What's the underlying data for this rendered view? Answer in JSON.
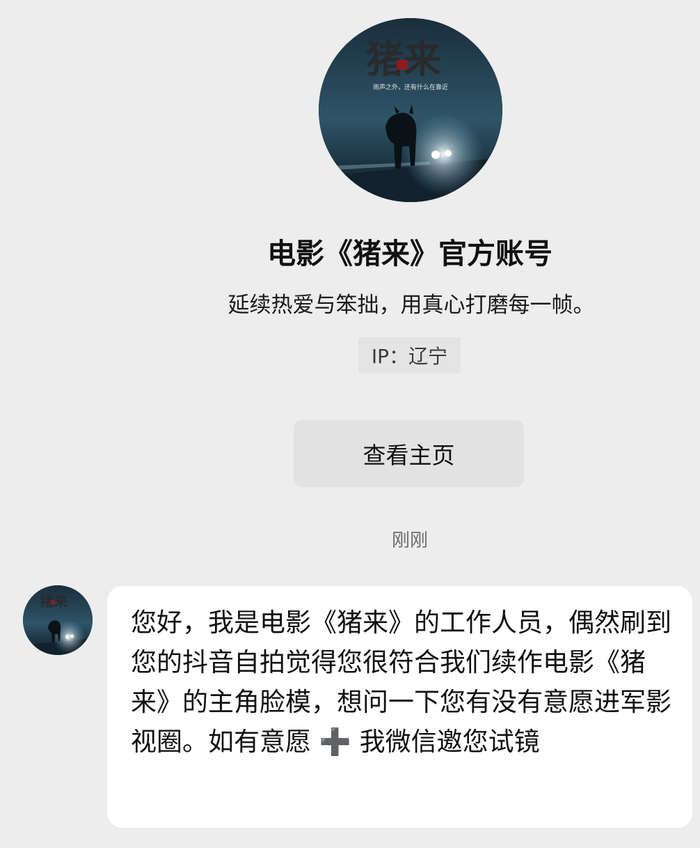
{
  "profile": {
    "avatar_icon": "movie-poster-avatar",
    "name": "电影《猪来》官方账号",
    "bio": "延续热爱与笨拙，用真心打磨每一帧。",
    "ip_location": "IP：辽宁",
    "view_homepage_label": "查看主页"
  },
  "poster": {
    "title": "猪来",
    "tagline": "雨声之外，还有什么在靠近"
  },
  "chat": {
    "timestamp": "刚刚",
    "message": {
      "sender_avatar_icon": "movie-poster-avatar",
      "text": "您好，我是电影《猪来》的工作人员，偶然刷到您的抖音自拍觉得您很符合我们续作电影《猪来》的主角脸模，想问一下您有没有意愿进军影视圈。如有意愿 ➕ 我微信邀您试镜"
    }
  },
  "colors": {
    "background": "#ededed",
    "bubble": "#ffffff",
    "button": "#e2e2e2",
    "badge": "#e4e4e4"
  }
}
